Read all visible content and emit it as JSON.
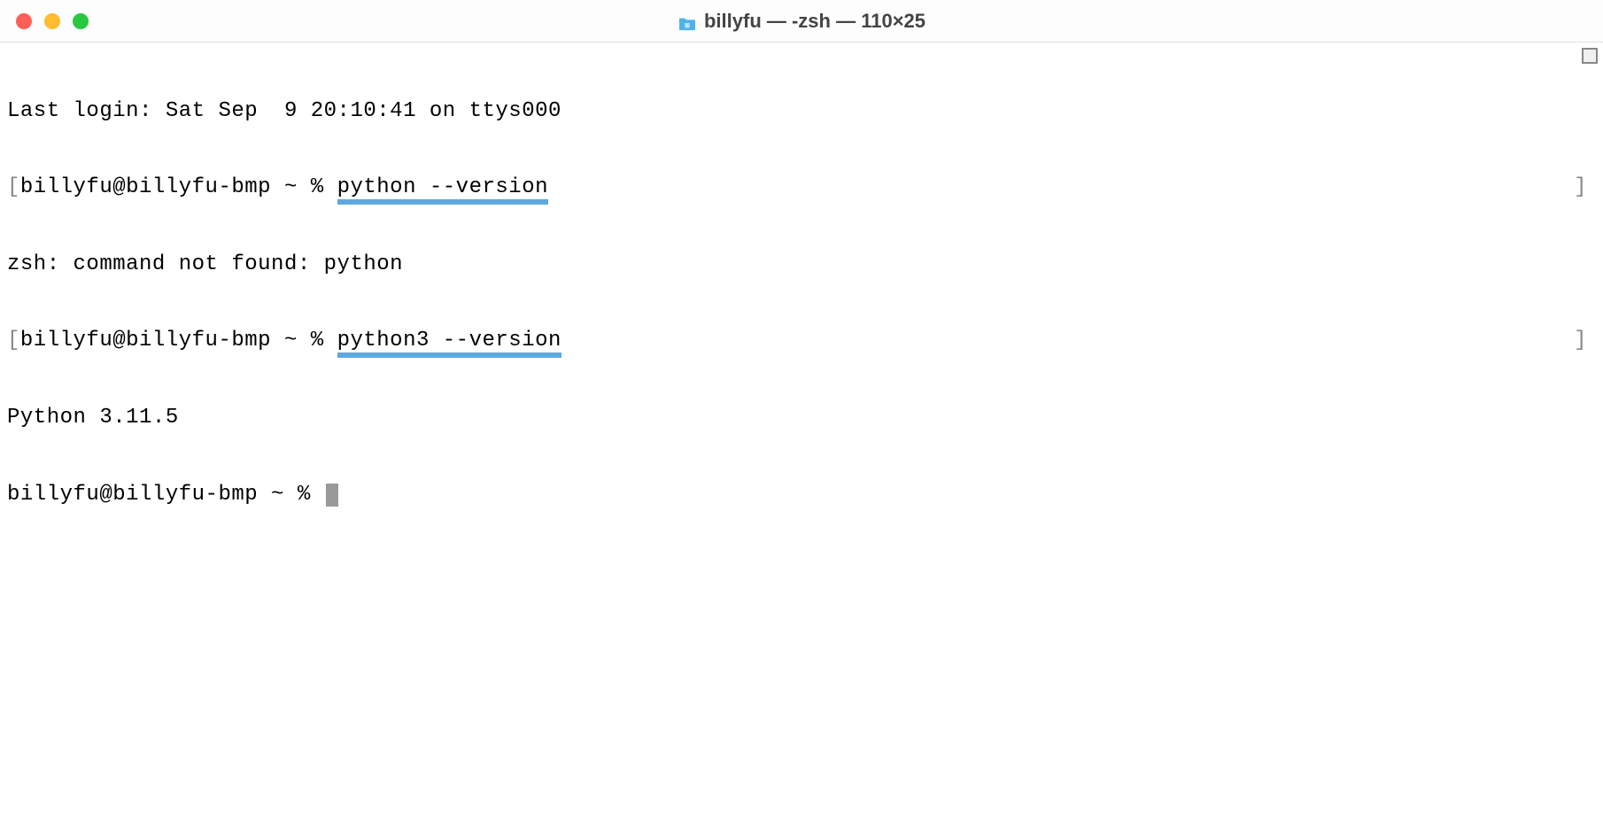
{
  "window": {
    "title": "billyfu — -zsh — 110×25"
  },
  "terminal": {
    "lines": {
      "last_login": "Last login: Sat Sep  9 20:10:41 on ttys000",
      "prompt1_bracket_open": "[",
      "prompt1_prefix": "billyfu@billyfu-bmp ~ % ",
      "prompt1_command": "python --version",
      "prompt1_bracket_close": "]",
      "output1": "zsh: command not found: python",
      "prompt2_bracket_open": "[",
      "prompt2_prefix": "billyfu@billyfu-bmp ~ % ",
      "prompt2_command": "python3 --version",
      "prompt2_bracket_close": "]",
      "output2": "Python 3.11.5",
      "prompt3_prefix": "billyfu@billyfu-bmp ~ % "
    }
  }
}
